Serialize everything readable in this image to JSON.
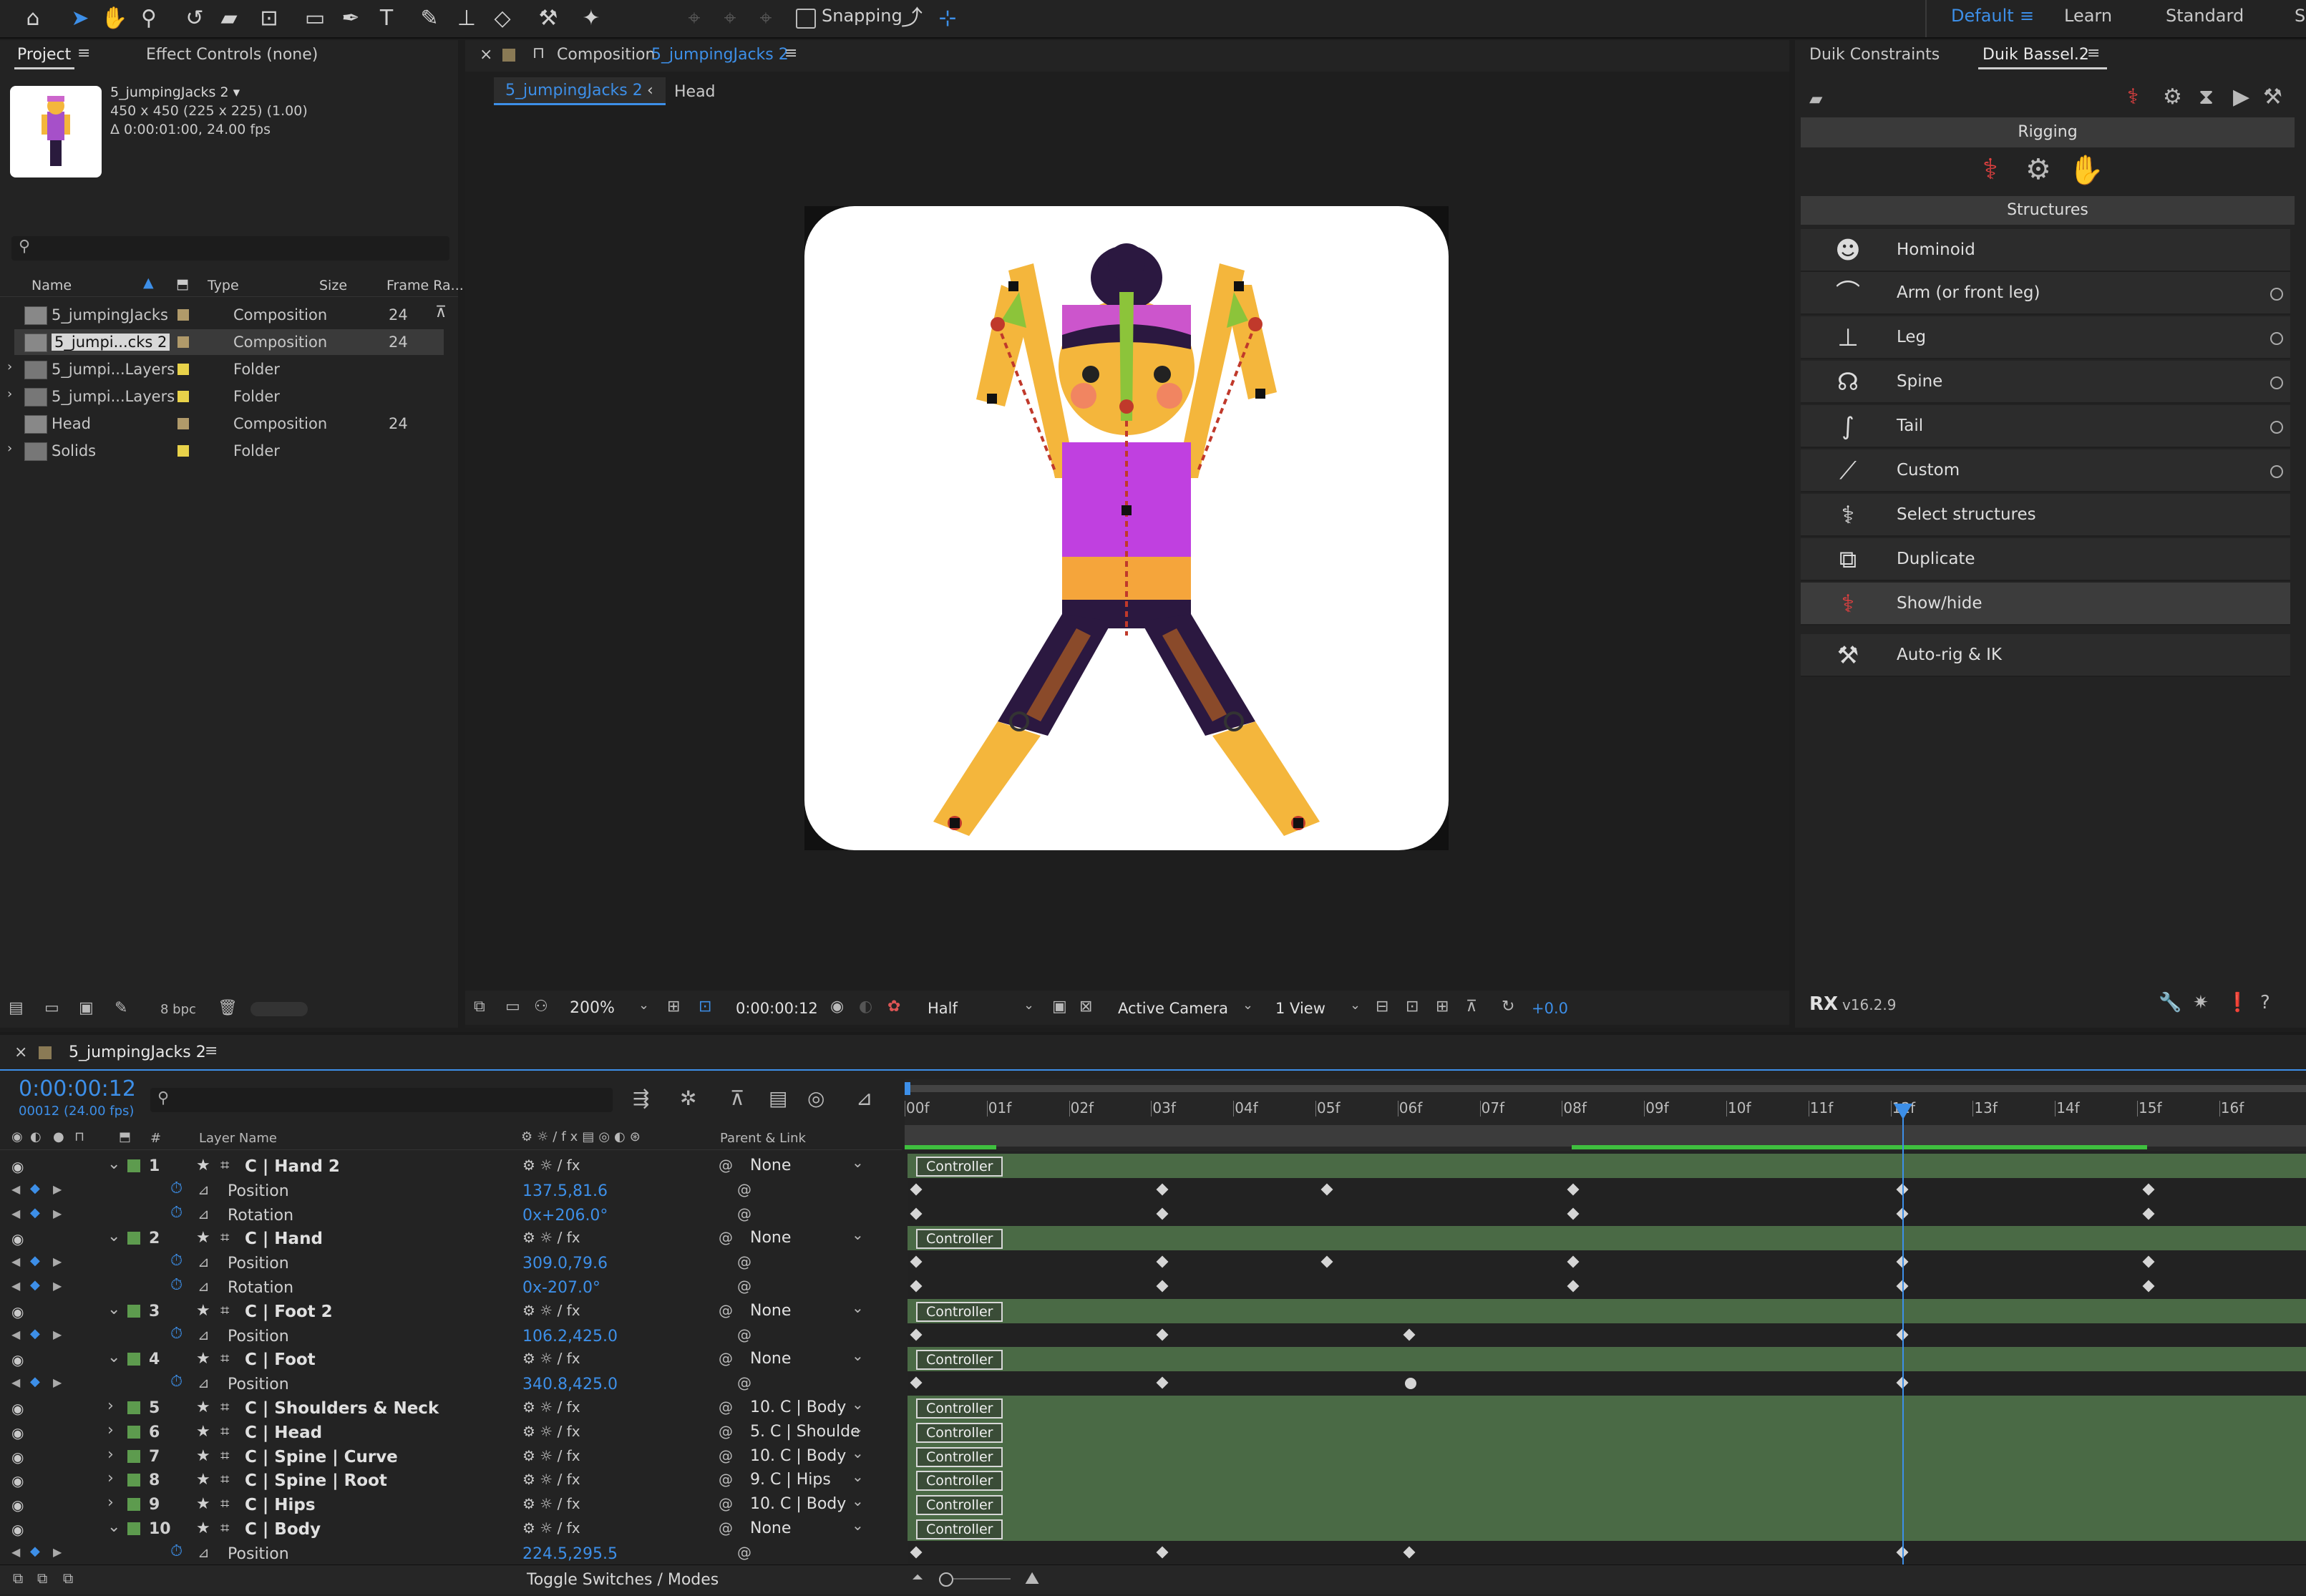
{
  "toolbar": {
    "snapping_label": "Snapping",
    "workspaces": [
      "Default",
      "Learn",
      "Standard",
      "Sr"
    ]
  },
  "project_panel": {
    "tab_project": "Project",
    "tab_effect_controls": "Effect Controls (none)",
    "comp_name": "5_jumpingJacks 2 ▾",
    "comp_size": "450 x 450  (225 x 225) (1.00)",
    "comp_duration": "Δ 0:00:01:00, 24.00 fps",
    "columns": [
      "Name",
      "Type",
      "Size",
      "Frame Ra..."
    ],
    "items": [
      {
        "name": "5_jumpingJacks",
        "type": "Composition",
        "frame_rate": "24",
        "color": "#b09a6a"
      },
      {
        "name": "5_jumpi...cks 2",
        "type": "Composition",
        "frame_rate": "24",
        "color": "#b09a6a"
      },
      {
        "name": "5_jumpi...Layers",
        "type": "Folder",
        "frame_rate": "",
        "color": "#e8d24a"
      },
      {
        "name": "5_jumpi...Layers",
        "type": "Folder",
        "frame_rate": "",
        "color": "#e8d24a"
      },
      {
        "name": "Head",
        "type": "Composition",
        "frame_rate": "24",
        "color": "#b09a6a"
      },
      {
        "name": "Solids",
        "type": "Folder",
        "frame_rate": "",
        "color": "#e8d24a"
      }
    ],
    "bpc": "8 bpc"
  },
  "composition_panel": {
    "title_prefix": "Composition",
    "title_comp": "5_jumpingJacks 2",
    "breadcrumb_current": "5_jumpingJacks 2",
    "breadcrumb_next": "Head",
    "zoom": "200%",
    "timecode": "0:00:00:12",
    "resolution": "Half",
    "camera": "Active Camera",
    "view": "1 View",
    "exposure": "+0.0"
  },
  "duik_panel": {
    "tab_constraints": "Duik Constraints",
    "tab_bassel": "Duik Bassel.2",
    "section_rigging": "Rigging",
    "section_structures": "Structures",
    "items": [
      {
        "label": "Hominoid",
        "icon": "hominoid-icon",
        "has_dot": false
      },
      {
        "label": "Arm (or front leg)",
        "icon": "arm-icon",
        "has_dot": true
      },
      {
        "label": "Leg",
        "icon": "leg-icon",
        "has_dot": true
      },
      {
        "label": "Spine",
        "icon": "spine-icon",
        "has_dot": true
      },
      {
        "label": "Tail",
        "icon": "tail-icon",
        "has_dot": true
      },
      {
        "label": "Custom",
        "icon": "custom-icon",
        "has_dot": true
      },
      {
        "label": "Select structures",
        "icon": "select-structures-icon",
        "has_dot": false
      },
      {
        "label": "Duplicate",
        "icon": "duplicate-icon",
        "has_dot": false
      },
      {
        "label": "Show/hide",
        "icon": "show-hide-icon",
        "has_dot": false
      },
      {
        "label": "Auto-rig & IK",
        "icon": "auto-rig-icon",
        "has_dot": false
      }
    ],
    "version": "v16.2.9"
  },
  "timeline": {
    "comp_tab": "5_jumpingJacks 2",
    "timecode": "0:00:00:12",
    "frame_info": "00012 (24.00 fps)",
    "col_layer_name": "Layer Name",
    "col_parent": "Parent & Link",
    "ruler_labels": [
      "00f",
      "01f",
      "02f",
      "03f",
      "04f",
      "05f",
      "06f",
      "07f",
      "08f",
      "09f",
      "10f",
      "11f",
      "12f",
      "13f",
      "14f",
      "15f",
      "16f"
    ],
    "current_frame": 12,
    "rows": [
      {
        "kind": "layer",
        "num": "1",
        "name": "C | Hand 2",
        "parent": "None",
        "expanded": true
      },
      {
        "kind": "prop",
        "name": "Position",
        "value": "137.5,81.6",
        "keys": [
          0,
          3,
          5,
          8,
          12,
          15
        ]
      },
      {
        "kind": "prop",
        "name": "Rotation",
        "value": "0x+206.0°",
        "keys": [
          0,
          3,
          8,
          12,
          15
        ]
      },
      {
        "kind": "layer",
        "num": "2",
        "name": "C | Hand",
        "parent": "None",
        "expanded": true
      },
      {
        "kind": "prop",
        "name": "Position",
        "value": "309.0,79.6",
        "keys": [
          0,
          3,
          5,
          8,
          12,
          15
        ]
      },
      {
        "kind": "prop",
        "name": "Rotation",
        "value": "0x-207.0°",
        "keys": [
          0,
          3,
          8,
          12,
          15
        ]
      },
      {
        "kind": "layer",
        "num": "3",
        "name": "C | Foot 2",
        "parent": "None",
        "expanded": true
      },
      {
        "kind": "prop",
        "name": "Position",
        "value": "106.2,425.0",
        "keys": [
          0,
          3,
          6,
          12
        ]
      },
      {
        "kind": "layer",
        "num": "4",
        "name": "C | Foot",
        "parent": "None",
        "expanded": true
      },
      {
        "kind": "prop",
        "name": "Position",
        "value": "340.8,425.0",
        "keys": [
          0,
          3,
          6,
          12
        ],
        "circle_key": 6
      },
      {
        "kind": "layer",
        "num": "5",
        "name": "C | Shoulders & Neck",
        "parent": "10. C | Body",
        "expanded": false
      },
      {
        "kind": "layer",
        "num": "6",
        "name": "C | Head",
        "parent": "5. C | Shoulde",
        "expanded": false
      },
      {
        "kind": "layer",
        "num": "7",
        "name": "C | Spine | Curve",
        "parent": "10. C | Body",
        "expanded": false
      },
      {
        "kind": "layer",
        "num": "8",
        "name": "C | Spine | Root",
        "parent": "9. C | Hips",
        "expanded": false
      },
      {
        "kind": "layer",
        "num": "9",
        "name": "C | Hips",
        "parent": "10. C | Body",
        "expanded": false
      },
      {
        "kind": "layer",
        "num": "10",
        "name": "C | Body",
        "parent": "None",
        "expanded": true
      },
      {
        "kind": "prop",
        "name": "Position",
        "value": "224.5,295.5",
        "keys": [
          0,
          3,
          6,
          12
        ]
      }
    ],
    "controller_label": "Controller",
    "footer_toggle": "Toggle Switches / Modes"
  }
}
